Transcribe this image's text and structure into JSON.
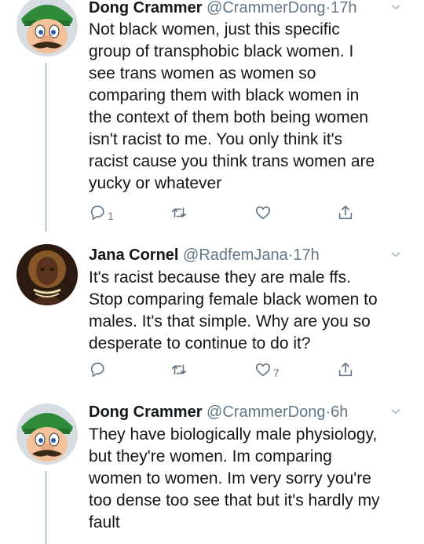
{
  "tweets": [
    {
      "name": "Dong Crammer",
      "handle": "@CrammerDong",
      "dot": "·",
      "time": "17h",
      "lines": [
        "Not black women, just this specific",
        "group of transphobic black women. I",
        "see trans women as women so",
        "comparing them with black women in",
        "the context of them both being women",
        "isn't racist to me. You only think it's",
        "racist cause you think trans women are",
        "yucky or whatever"
      ],
      "reply_count": "1",
      "retweet_count": "",
      "like_count": ""
    },
    {
      "name": "Jana Cornel",
      "handle": "@RadfemJana",
      "dot": "·",
      "time": "17h",
      "lines": [
        "It's racist because they are male ffs.",
        "Stop comparing female black women to",
        "males. It's that simple. Why are you so",
        "desperate to continue to do it?"
      ],
      "reply_count": "",
      "retweet_count": "",
      "like_count": "7"
    },
    {
      "name": "Dong Crammer",
      "handle": "@CrammerDong",
      "dot": "·",
      "time": "6h",
      "lines": [
        "They have biologically male physiology,",
        "but they're women. Im comparing",
        "women to women. Im very sorry you're",
        "too dense too see that but it's hardly my",
        "fault"
      ]
    }
  ],
  "icons": {
    "reply": "reply-icon",
    "retweet": "retweet-icon",
    "like": "heart-icon",
    "share": "share-icon",
    "caret": "chevron-down-icon"
  },
  "colors": {
    "text": "#14171a",
    "secondary": "#657786",
    "thread_line": "#ccd6dd"
  }
}
